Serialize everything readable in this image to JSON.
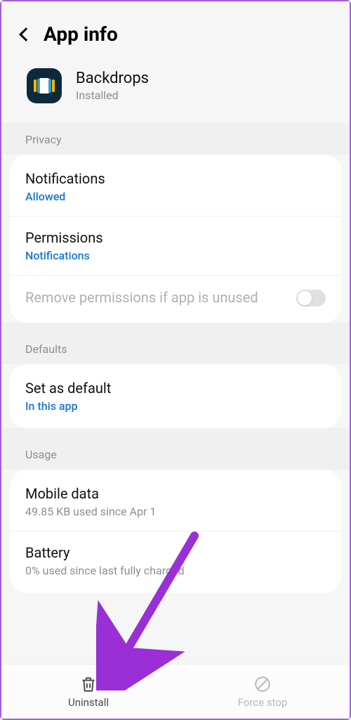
{
  "header": {
    "title": "App info"
  },
  "app": {
    "name": "Backdrops",
    "status": "Installed"
  },
  "sections": {
    "privacy": {
      "label": "Privacy",
      "notifications": {
        "title": "Notifications",
        "value": "Allowed"
      },
      "permissions": {
        "title": "Permissions",
        "value": "Notifications"
      },
      "remove": {
        "title": "Remove permissions if app is unused",
        "on": false
      }
    },
    "defaults": {
      "label": "Defaults",
      "set_default": {
        "title": "Set as default",
        "value": "In this app"
      }
    },
    "usage": {
      "label": "Usage",
      "mobile_data": {
        "title": "Mobile data",
        "value": "49.85 KB used since Apr 1"
      },
      "battery": {
        "title": "Battery",
        "value": "0% used since last fully charged"
      }
    }
  },
  "bottom": {
    "uninstall": "Uninstall",
    "force_stop": "Force stop"
  }
}
